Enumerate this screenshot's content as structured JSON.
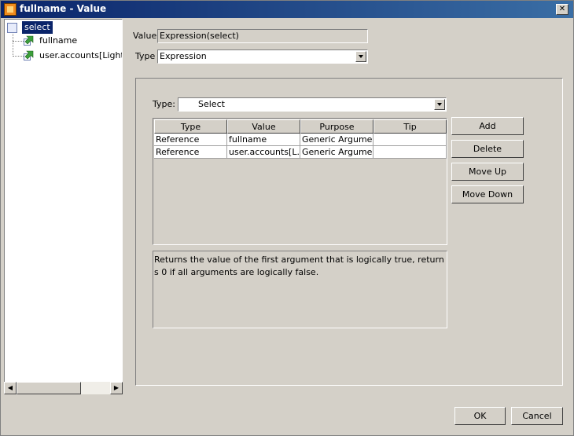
{
  "window": {
    "title": "fullname - Value"
  },
  "tree": {
    "root": "select",
    "children": [
      "fullname",
      "user.accounts[Lightho"
    ]
  },
  "value_field": {
    "label": "Value",
    "value": "Expression(select)"
  },
  "type_field": {
    "label": "Type",
    "selected": "Expression"
  },
  "inner_type": {
    "label": "Type:",
    "selected": "Select"
  },
  "table": {
    "headers": [
      "Type",
      "Value",
      "Purpose",
      "Tip"
    ],
    "rows": [
      [
        "Reference",
        "fullname",
        "Generic Argument",
        ""
      ],
      [
        "Reference",
        "user.accounts[L...",
        "Generic Argument",
        ""
      ]
    ]
  },
  "buttons": {
    "add": "Add",
    "delete": "Delete",
    "move_up": "Move Up",
    "move_down": "Move Down",
    "ok": "OK",
    "cancel": "Cancel"
  },
  "description": "Returns the value of the first argument that is logically true, returns 0 if all arguments are logically false.",
  "colors": {
    "title_bar": "#0a246a",
    "selection": "#0a246a",
    "face": "#d4d0c8"
  },
  "icons": {
    "app": "value-app-icon",
    "root": "function-node-icon",
    "child": "reference-arrow-icon",
    "close": "close-icon"
  }
}
